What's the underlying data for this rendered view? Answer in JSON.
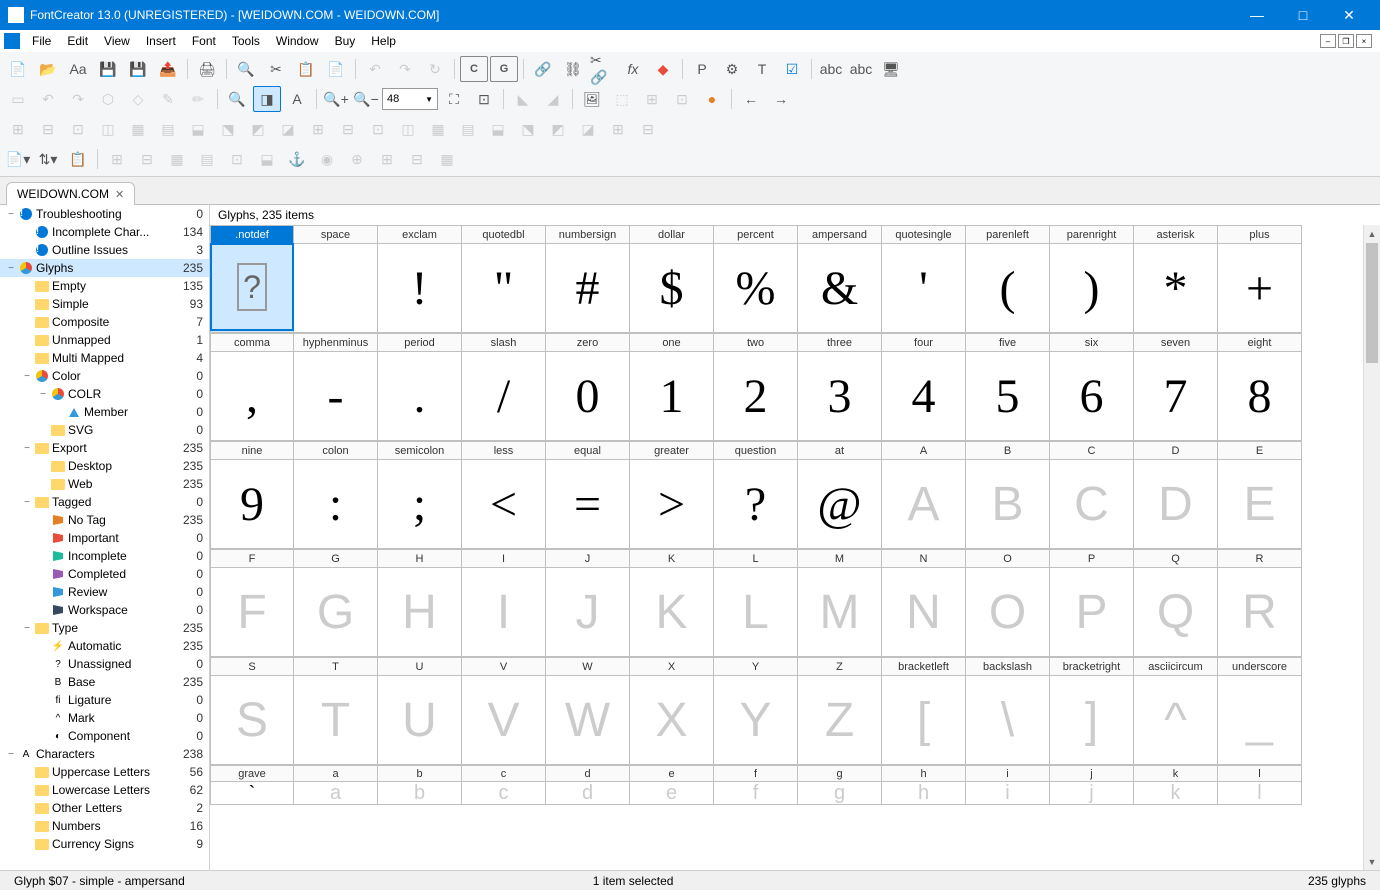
{
  "title": "FontCreator 13.0 (UNREGISTERED) - [WEIDOWN.COM - WEIDOWN.COM]",
  "menu": [
    "File",
    "Edit",
    "View",
    "Insert",
    "Font",
    "Tools",
    "Window",
    "Buy",
    "Help"
  ],
  "tab": "WEIDOWN.COM",
  "zoom_value": "48",
  "panel_title": "Glyphs, 235 items",
  "status": {
    "left": "Glyph $07 - simple - ampersand",
    "center": "1 item selected",
    "right": "235 glyphs"
  },
  "tree": [
    {
      "d": 0,
      "tw": "−",
      "ic": "info",
      "label": "Troubleshooting",
      "count": 0
    },
    {
      "d": 1,
      "tw": "",
      "ic": "info",
      "label": "Incomplete Char...",
      "count": 134
    },
    {
      "d": 1,
      "tw": "",
      "ic": "info",
      "label": "Outline Issues",
      "count": 3
    },
    {
      "d": 0,
      "tw": "−",
      "ic": "pie",
      "label": "Glyphs",
      "count": 235,
      "sel": true
    },
    {
      "d": 1,
      "tw": "",
      "ic": "folder",
      "label": "Empty",
      "count": 135
    },
    {
      "d": 1,
      "tw": "",
      "ic": "folder",
      "label": "Simple",
      "count": 93
    },
    {
      "d": 1,
      "tw": "",
      "ic": "folder",
      "label": "Composite",
      "count": 7
    },
    {
      "d": 1,
      "tw": "",
      "ic": "folder",
      "label": "Unmapped",
      "count": 1
    },
    {
      "d": 1,
      "tw": "",
      "ic": "folder",
      "label": "Multi Mapped",
      "count": 4
    },
    {
      "d": 1,
      "tw": "−",
      "ic": "pie",
      "label": "Color",
      "count": 0
    },
    {
      "d": 2,
      "tw": "−",
      "ic": "pie",
      "label": "COLR",
      "count": 0
    },
    {
      "d": 3,
      "tw": "",
      "ic": "tri",
      "label": "Member",
      "count": 0
    },
    {
      "d": 2,
      "tw": "",
      "ic": "folder",
      "label": "SVG",
      "count": 0
    },
    {
      "d": 1,
      "tw": "−",
      "ic": "folder",
      "label": "Export",
      "count": 235
    },
    {
      "d": 2,
      "tw": "",
      "ic": "folder",
      "label": "Desktop",
      "count": 235
    },
    {
      "d": 2,
      "tw": "",
      "ic": "folder",
      "label": "Web",
      "count": 235
    },
    {
      "d": 1,
      "tw": "−",
      "ic": "folder",
      "label": "Tagged",
      "count": 0
    },
    {
      "d": 2,
      "tw": "",
      "ic": "flag",
      "clr": "#e67e22",
      "label": "No Tag",
      "count": 235
    },
    {
      "d": 2,
      "tw": "",
      "ic": "flag",
      "clr": "#e74c3c",
      "label": "Important",
      "count": 0
    },
    {
      "d": 2,
      "tw": "",
      "ic": "flag",
      "clr": "#1abc9c",
      "label": "Incomplete",
      "count": 0
    },
    {
      "d": 2,
      "tw": "",
      "ic": "flag",
      "clr": "#9b59b6",
      "label": "Completed",
      "count": 0
    },
    {
      "d": 2,
      "tw": "",
      "ic": "flag",
      "clr": "#3498db",
      "label": "Review",
      "count": 0
    },
    {
      "d": 2,
      "tw": "",
      "ic": "flag",
      "clr": "#34495e",
      "label": "Workspace",
      "count": 0
    },
    {
      "d": 1,
      "tw": "−",
      "ic": "folder",
      "label": "Type",
      "count": 235
    },
    {
      "d": 2,
      "tw": "",
      "ic": "txt",
      "g": "⚡",
      "label": "Automatic",
      "count": 235
    },
    {
      "d": 2,
      "tw": "",
      "ic": "txt",
      "g": "?",
      "label": "Unassigned",
      "count": 0
    },
    {
      "d": 2,
      "tw": "",
      "ic": "txt",
      "g": "B",
      "label": "Base",
      "count": 235
    },
    {
      "d": 2,
      "tw": "",
      "ic": "txt",
      "g": "fi",
      "label": "Ligature",
      "count": 0
    },
    {
      "d": 2,
      "tw": "",
      "ic": "txt",
      "g": "^",
      "label": "Mark",
      "count": 0
    },
    {
      "d": 2,
      "tw": "",
      "ic": "txt",
      "g": "◐",
      "label": "Component",
      "count": 0
    },
    {
      "d": 0,
      "tw": "−",
      "ic": "txt",
      "g": "A",
      "label": "Characters",
      "count": 238
    },
    {
      "d": 1,
      "tw": "",
      "ic": "folder",
      "label": "Uppercase Letters",
      "count": 56
    },
    {
      "d": 1,
      "tw": "",
      "ic": "folder",
      "label": "Lowercase Letters",
      "count": 62
    },
    {
      "d": 1,
      "tw": "",
      "ic": "folder",
      "label": "Other Letters",
      "count": 2
    },
    {
      "d": 1,
      "tw": "",
      "ic": "folder",
      "label": "Numbers",
      "count": 16
    },
    {
      "d": 1,
      "tw": "",
      "ic": "folder",
      "label": "Currency Signs",
      "count": 9
    }
  ],
  "glyph_rows": [
    [
      {
        "n": ".notdef",
        "g": "?",
        "sel": true,
        "notdef": true
      },
      {
        "n": "space",
        "g": " "
      },
      {
        "n": "exclam",
        "g": "!"
      },
      {
        "n": "quotedbl",
        "g": "\""
      },
      {
        "n": "numbersign",
        "g": "#"
      },
      {
        "n": "dollar",
        "g": "$"
      },
      {
        "n": "percent",
        "g": "%"
      },
      {
        "n": "ampersand",
        "g": "&"
      },
      {
        "n": "quotesingle",
        "g": "'"
      },
      {
        "n": "parenleft",
        "g": "("
      },
      {
        "n": "parenright",
        "g": ")"
      },
      {
        "n": "asterisk",
        "g": "*"
      },
      {
        "n": "plus",
        "g": "+"
      }
    ],
    [
      {
        "n": "comma",
        "g": ","
      },
      {
        "n": "hyphenminus",
        "g": "-"
      },
      {
        "n": "period",
        "g": "."
      },
      {
        "n": "slash",
        "g": "/"
      },
      {
        "n": "zero",
        "g": "0"
      },
      {
        "n": "one",
        "g": "1"
      },
      {
        "n": "two",
        "g": "2"
      },
      {
        "n": "three",
        "g": "3"
      },
      {
        "n": "four",
        "g": "4"
      },
      {
        "n": "five",
        "g": "5"
      },
      {
        "n": "six",
        "g": "6"
      },
      {
        "n": "seven",
        "g": "7"
      },
      {
        "n": "eight",
        "g": "8"
      }
    ],
    [
      {
        "n": "nine",
        "g": "9"
      },
      {
        "n": "colon",
        "g": ":"
      },
      {
        "n": "semicolon",
        "g": ";"
      },
      {
        "n": "less",
        "g": "<"
      },
      {
        "n": "equal",
        "g": "="
      },
      {
        "n": "greater",
        "g": ">"
      },
      {
        "n": "question",
        "g": "?"
      },
      {
        "n": "at",
        "g": "@"
      },
      {
        "n": "A",
        "g": "A",
        "e": true
      },
      {
        "n": "B",
        "g": "B",
        "e": true
      },
      {
        "n": "C",
        "g": "C",
        "e": true
      },
      {
        "n": "D",
        "g": "D",
        "e": true
      },
      {
        "n": "E",
        "g": "E",
        "e": true
      }
    ],
    [
      {
        "n": "F",
        "g": "F",
        "e": true
      },
      {
        "n": "G",
        "g": "G",
        "e": true
      },
      {
        "n": "H",
        "g": "H",
        "e": true
      },
      {
        "n": "I",
        "g": "I",
        "e": true
      },
      {
        "n": "J",
        "g": "J",
        "e": true
      },
      {
        "n": "K",
        "g": "K",
        "e": true
      },
      {
        "n": "L",
        "g": "L",
        "e": true
      },
      {
        "n": "M",
        "g": "M",
        "e": true
      },
      {
        "n": "N",
        "g": "N",
        "e": true
      },
      {
        "n": "O",
        "g": "O",
        "e": true
      },
      {
        "n": "P",
        "g": "P",
        "e": true
      },
      {
        "n": "Q",
        "g": "Q",
        "e": true
      },
      {
        "n": "R",
        "g": "R",
        "e": true
      }
    ],
    [
      {
        "n": "S",
        "g": "S",
        "e": true
      },
      {
        "n": "T",
        "g": "T",
        "e": true
      },
      {
        "n": "U",
        "g": "U",
        "e": true
      },
      {
        "n": "V",
        "g": "V",
        "e": true
      },
      {
        "n": "W",
        "g": "W",
        "e": true
      },
      {
        "n": "X",
        "g": "X",
        "e": true
      },
      {
        "n": "Y",
        "g": "Y",
        "e": true
      },
      {
        "n": "Z",
        "g": "Z",
        "e": true
      },
      {
        "n": "bracketleft",
        "g": "[",
        "e": true
      },
      {
        "n": "backslash",
        "g": "\\",
        "e": true
      },
      {
        "n": "bracketright",
        "g": "]",
        "e": true
      },
      {
        "n": "asciicircum",
        "g": "^",
        "e": true
      },
      {
        "n": "underscore",
        "g": "_",
        "e": true
      }
    ],
    [
      {
        "n": "grave",
        "g": "`"
      },
      {
        "n": "a",
        "g": "a",
        "e": true
      },
      {
        "n": "b",
        "g": "b",
        "e": true
      },
      {
        "n": "c",
        "g": "c",
        "e": true
      },
      {
        "n": "d",
        "g": "d",
        "e": true
      },
      {
        "n": "e",
        "g": "e",
        "e": true
      },
      {
        "n": "f",
        "g": "f",
        "e": true
      },
      {
        "n": "g",
        "g": "g",
        "e": true
      },
      {
        "n": "h",
        "g": "h",
        "e": true
      },
      {
        "n": "i",
        "g": "i",
        "e": true
      },
      {
        "n": "j",
        "g": "j",
        "e": true
      },
      {
        "n": "k",
        "g": "k",
        "e": true
      },
      {
        "n": "l",
        "g": "l",
        "e": true
      }
    ]
  ]
}
